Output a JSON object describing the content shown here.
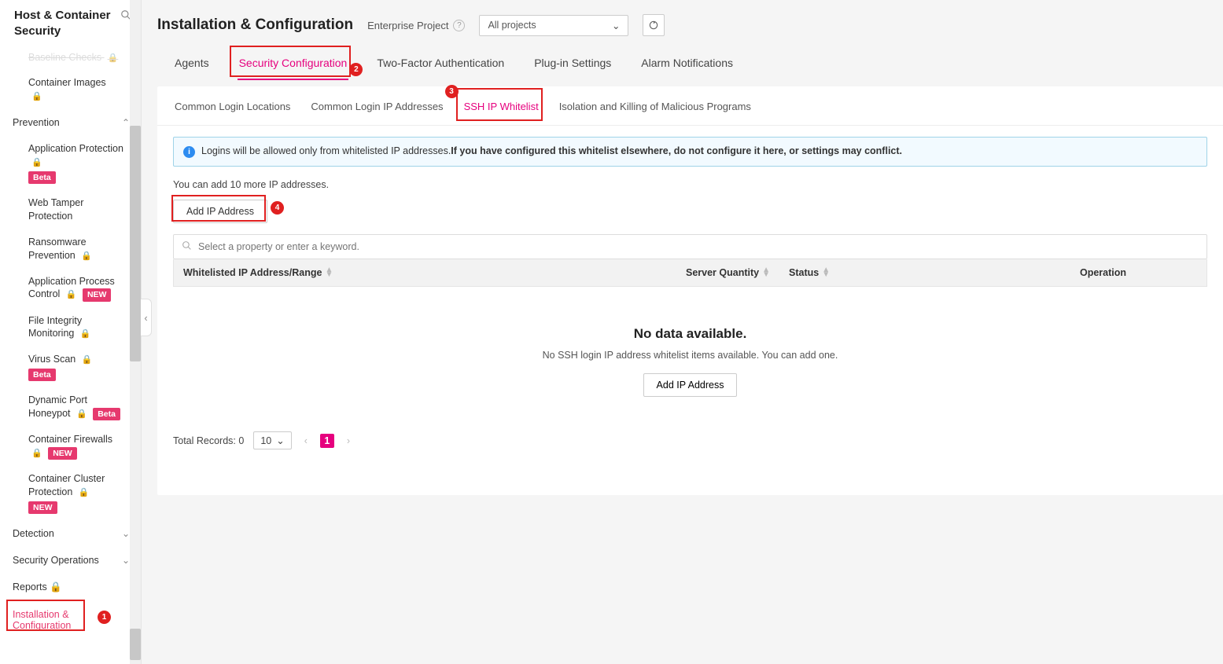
{
  "sidebar": {
    "title": "Host & Container Security",
    "partial_top_item": "Baseline Checks",
    "container_images": "Container Images",
    "groups": {
      "prevention": {
        "label": "Prevention",
        "expanded": true,
        "items": [
          {
            "label": "Application Protection",
            "lock": true,
            "badge": "Beta"
          },
          {
            "label": "Web Tamper Protection"
          },
          {
            "label": "Ransomware Prevention",
            "lock": true
          },
          {
            "label": "Application Process Control",
            "lock": true,
            "badge_inline": "NEW"
          },
          {
            "label": "File Integrity Monitoring",
            "lock": true
          },
          {
            "label": "Virus Scan",
            "lock": true,
            "badge": "Beta"
          },
          {
            "label": "Dynamic Port Honeypot",
            "lock": true,
            "badge_inline": "Beta"
          },
          {
            "label": "Container Firewalls",
            "lock": true,
            "badge": "NEW"
          },
          {
            "label": "Container Cluster Protection",
            "lock": true,
            "badge": "NEW"
          }
        ]
      },
      "detection": {
        "label": "Detection",
        "expanded": false
      },
      "security_ops": {
        "label": "Security Operations",
        "expanded": false
      }
    },
    "reports": "Reports",
    "install_config": "Installation & Configuration"
  },
  "header": {
    "title": "Installation & Configuration",
    "ep_label": "Enterprise Project",
    "ep_selected": "All projects"
  },
  "tabs1": [
    {
      "label": "Agents",
      "active": false
    },
    {
      "label": "Security Configuration",
      "active": true
    },
    {
      "label": "Two-Factor Authentication",
      "active": false
    },
    {
      "label": "Plug-in Settings",
      "active": false
    },
    {
      "label": "Alarm Notifications",
      "active": false
    }
  ],
  "tabs2": [
    {
      "label": "Common Login Locations",
      "active": false
    },
    {
      "label": "Common Login IP Addresses",
      "active": false
    },
    {
      "label": "SSH IP Whitelist",
      "active": true
    },
    {
      "label": "Isolation and Killing of Malicious Programs",
      "active": false
    }
  ],
  "banner": {
    "text_a": "Logins will be allowed only from whitelisted IP addresses.",
    "text_b": "If you have configured this whitelist elsewhere, do not configure it here, or settings may conflict."
  },
  "quota_text": "You can add 10 more IP addresses.",
  "add_btn": "Add IP Address",
  "search_placeholder": "Select a property or enter a keyword.",
  "columns": {
    "ip": "Whitelisted IP Address/Range",
    "qty": "Server Quantity",
    "status": "Status",
    "op": "Operation"
  },
  "empty": {
    "heading": "No data available.",
    "sub": "No SSH login IP address whitelist items available. You can add one.",
    "btn": "Add IP Address"
  },
  "pager": {
    "total_label": "Total Records: 0",
    "page_size": "10",
    "current": "1"
  },
  "markers": {
    "1": "1",
    "2": "2",
    "3": "3",
    "4": "4"
  }
}
